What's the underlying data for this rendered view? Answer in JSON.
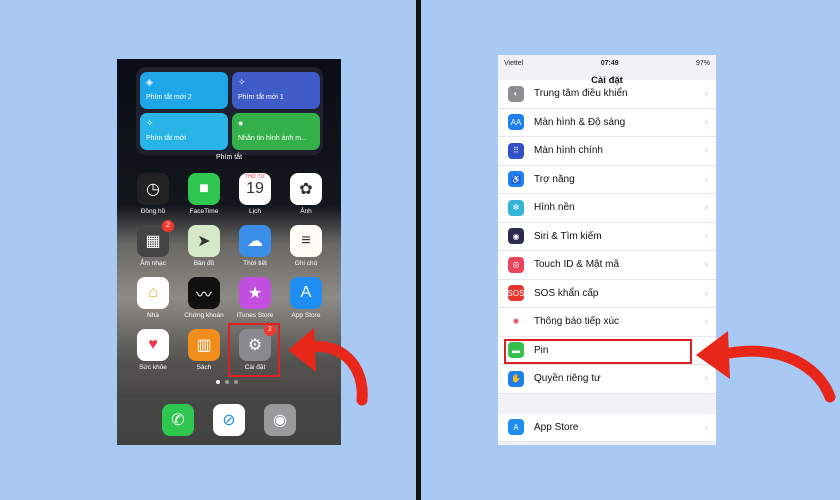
{
  "home": {
    "widget": {
      "label": "Phím tắt",
      "buttons": [
        {
          "label": "Phím tắt mới 2",
          "color": "#1fa6e8",
          "icon": "layers-icon"
        },
        {
          "label": "Phím tắt mới 1",
          "color": "#3f5bc8",
          "icon": "sparkle-icon"
        },
        {
          "label": "Phím tắt mới",
          "color": "#28b4e6",
          "icon": "sparkle-icon"
        },
        {
          "label": "Nhắn tin hình ảnh m...",
          "color": "#34b04a",
          "icon": "message-icon"
        }
      ]
    },
    "apps": [
      {
        "label": "Đồng hồ",
        "color": "#222",
        "glyph": "◷"
      },
      {
        "label": "FaceTime",
        "color": "#2fc650",
        "glyph": "■"
      },
      {
        "label": "Lịch",
        "color": "#ffffff",
        "glyph": "19",
        "sub": "THỨ TƯ"
      },
      {
        "label": "Ảnh",
        "color": "#ffffff",
        "glyph": "✿"
      },
      {
        "label": "Âm nhạc",
        "color": "#444",
        "glyph": "▦",
        "badge": "2"
      },
      {
        "label": "Bản đồ",
        "color": "#d6e9c8",
        "glyph": "➤"
      },
      {
        "label": "Thời tiết",
        "color": "#3a8ee8",
        "glyph": "☁"
      },
      {
        "label": "Ghi chú",
        "color": "#fdfdf6",
        "glyph": "≡"
      },
      {
        "label": "Nhà",
        "color": "#ffffff",
        "glyph": "⌂"
      },
      {
        "label": "Chứng khoán",
        "color": "#111",
        "glyph": "〰"
      },
      {
        "label": "iTunes Store",
        "color": "#c34fe0",
        "glyph": "★"
      },
      {
        "label": "App Store",
        "color": "#1e8ef3",
        "glyph": "A"
      },
      {
        "label": "Sức khỏe",
        "color": "#ffffff",
        "glyph": "♥"
      },
      {
        "label": "Sách",
        "color": "#f08d1c",
        "glyph": "▥"
      },
      {
        "label": "Cài đặt",
        "color": "#8a8a8e",
        "glyph": "⚙",
        "badge": "2"
      }
    ],
    "dock": [
      {
        "name": "phone",
        "color": "#2fc650",
        "glyph": "✆"
      },
      {
        "name": "safari",
        "color": "#ffffff",
        "glyph": "⊘"
      },
      {
        "name": "camera",
        "color": "#9a9a9e",
        "glyph": "◉"
      }
    ]
  },
  "settings": {
    "status": {
      "carrier": "Viettel",
      "time": "07:49",
      "battery": "97%"
    },
    "title": "Cài đặt",
    "rows": [
      {
        "label": "Trung tâm điều khiển",
        "color": "#8e8e93",
        "glyph": "◐"
      },
      {
        "label": "Màn hình & Độ sáng",
        "color": "#1e7ff0",
        "glyph": "AA"
      },
      {
        "label": "Màn hình chính",
        "color": "#3350c9",
        "glyph": "⠿"
      },
      {
        "label": "Trợ năng",
        "color": "#1e7ff0",
        "glyph": "♿"
      },
      {
        "label": "Hình nền",
        "color": "#35b5d8",
        "glyph": "✻"
      },
      {
        "label": "Siri & Tìm kiếm",
        "color": "#2b2b50",
        "glyph": "◉"
      },
      {
        "label": "Touch ID & Mật mã",
        "color": "#e8455c",
        "glyph": "◎"
      },
      {
        "label": "SOS khẩn cấp",
        "color": "#e2362e",
        "glyph": "SOS"
      },
      {
        "label": "Thông báo tiếp xúc",
        "color": "#ffffff",
        "glyph": "✺"
      },
      {
        "label": "Pin",
        "color": "#36c04c",
        "glyph": "▬"
      },
      {
        "label": "Quyền riêng tư",
        "color": "#1e7ff0",
        "glyph": "✋"
      }
    ],
    "rows2": [
      {
        "label": "App Store",
        "color": "#1e8ef3",
        "glyph": "A"
      }
    ]
  },
  "highlight_color": "#e02020"
}
